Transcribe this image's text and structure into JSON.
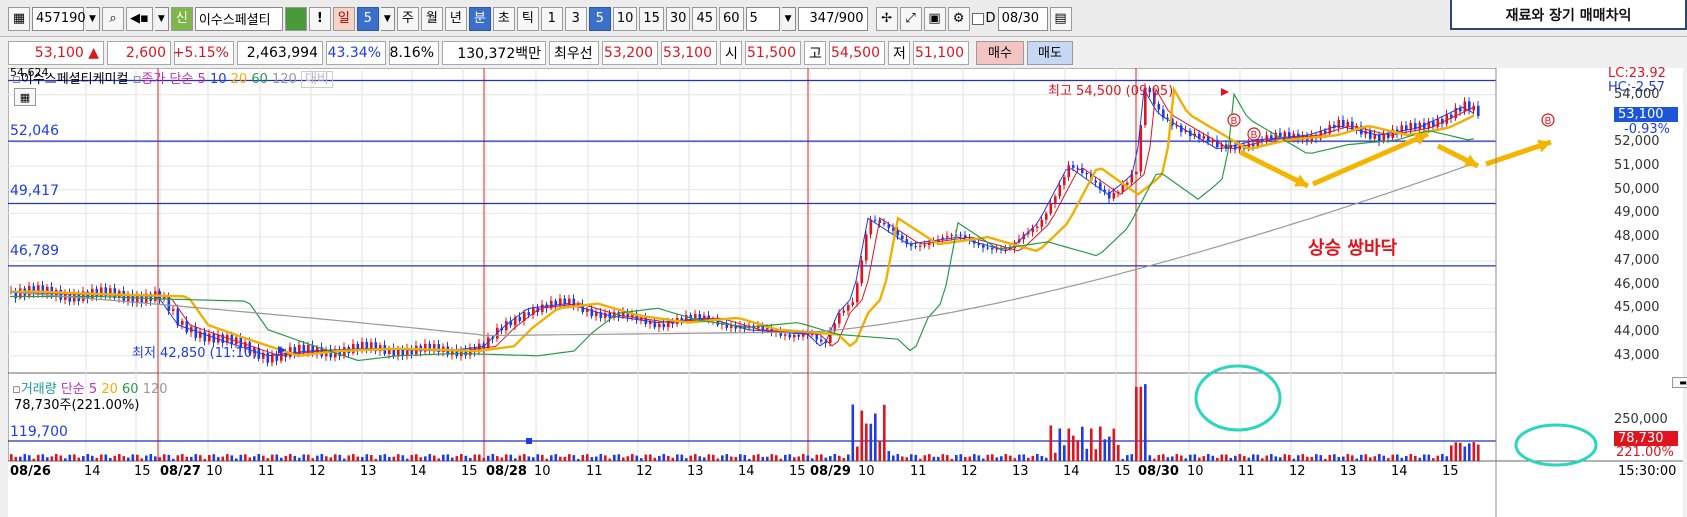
{
  "toolbar": {
    "code": "457190",
    "stock_name": "이수스페셜티",
    "period_label": "일",
    "period_count": "5",
    "buttons": [
      "주",
      "월",
      "년",
      "분",
      "초",
      "틱"
    ],
    "minute_steps": [
      "1",
      "3",
      "5",
      "10",
      "15",
      "30",
      "45",
      "60"
    ],
    "count_value": "5",
    "bar_count": "347/900",
    "d_check_label": "D",
    "date_value": "08/30",
    "right_banner_text": "재료와 장기 매매차익"
  },
  "quote": {
    "price": "53,100 ▲",
    "change": "2,600",
    "change_pct": "+5.15%",
    "volume": "2,463,994",
    "ratio1": "43.34%",
    "ratio2": "8.16%",
    "trade_value": "130,372백만",
    "best_bid_label": "최우선",
    "best_ask": "53,200",
    "best_bid": "53,100",
    "open_label": "시",
    "open": "51,500",
    "high_label": "고",
    "high": "54,500",
    "low_label": "저",
    "low": "51,100",
    "buy_label": "매수",
    "sell_label": "매도"
  },
  "price_panel": {
    "legend": {
      "name": "이수스페셜티케미컬",
      "ma_label": "종가 단순 5",
      "ma_10": "10",
      "ma_20": "20",
      "ma_60": "60",
      "ma_120": "120",
      "hidden_label": "대비"
    },
    "top_value": "54,624",
    "hlines": [
      "52,046",
      "49,417",
      "46,789"
    ],
    "lc": "LC:23.92",
    "hc": "HC:-2.57",
    "current_price": "53,100",
    "current_pct": "-0.93%",
    "y_ticks": [
      "54,000",
      "52,000",
      "51,000",
      "50,000",
      "49,000",
      "48,000",
      "47,000",
      "46,000",
      "45,000",
      "44,000",
      "43,000"
    ],
    "high_marker": "최고 54,500 (09:05)",
    "low_marker": "최저 42,850 (11:10)",
    "buy_markers": [
      "B",
      "B",
      "B"
    ],
    "annotation": "상승 쌍바닥"
  },
  "volume_panel": {
    "legend": {
      "name": "거래량",
      "ma_label": "단순 5",
      "ma_20": "20",
      "ma_60": "60",
      "ma_120": "120"
    },
    "current": "78,730주(221.00%)",
    "hline": "119,700",
    "y_tick": "250,000",
    "current_box": "78,730",
    "current_pct": "221.00%"
  },
  "time_axis": {
    "labels": [
      "08/26",
      "14",
      "15",
      "08/27",
      "10",
      "11",
      "12",
      "13",
      "14",
      "15",
      "08/28",
      "10",
      "11",
      "12",
      "13",
      "14",
      "15",
      "08/29",
      "10",
      "11",
      "12",
      "13",
      "14",
      "15",
      "08/30",
      "10",
      "11",
      "12",
      "13",
      "14",
      "15"
    ],
    "last_time": "15:30:00"
  },
  "colors": {
    "candle_up": "#e0141e",
    "candle_down": "#1d3ce8",
    "ma5": "#1d3ce8",
    "ma10": "#e0141e",
    "ma20": "#f0b000",
    "ma60": "#2a9a4a",
    "ma120": "#999999",
    "day_divider": "#cc2a2a",
    "arrow": "#f5b400",
    "highlight_circle": "#2ad6c0"
  }
}
